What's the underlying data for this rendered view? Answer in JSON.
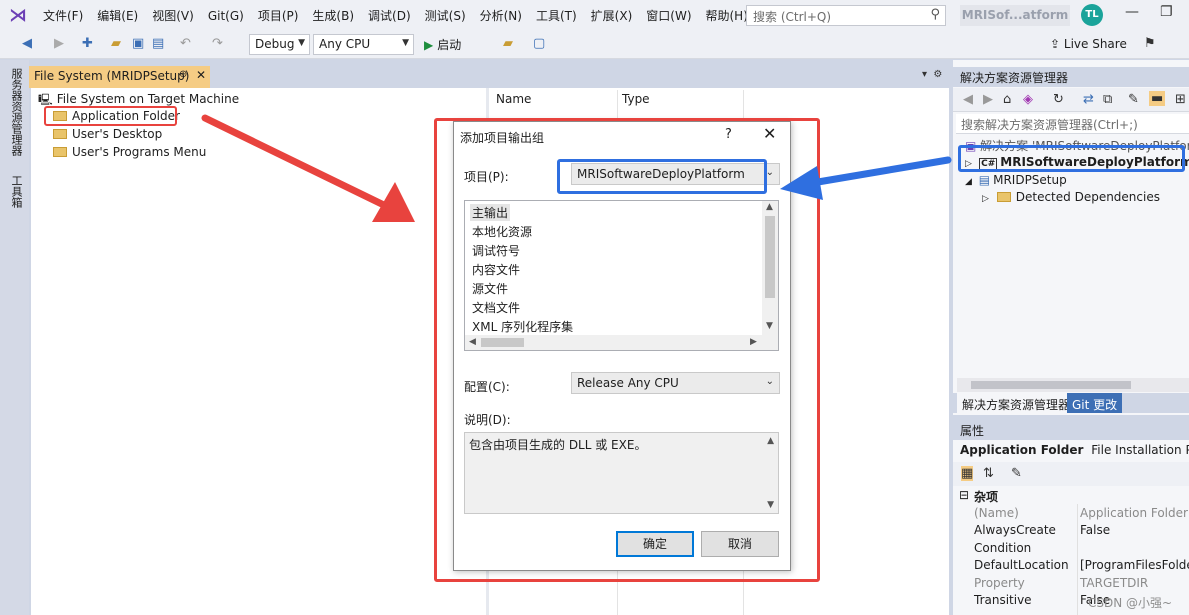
{
  "menubar": {
    "items": [
      "文件(F)",
      "编辑(E)",
      "视图(V)",
      "Git(G)",
      "项目(P)",
      "生成(B)",
      "调试(D)",
      "测试(S)",
      "分析(N)",
      "工具(T)",
      "扩展(X)",
      "窗口(W)",
      "帮助(H)"
    ],
    "search_placeholder": "搜索 (Ctrl+Q)",
    "app_name": "MRISof...atform",
    "avatar_initials": "TL"
  },
  "toolbar": {
    "config": "Debug",
    "platform": "Any CPU",
    "start_label": "启动",
    "live_share": "Live Share"
  },
  "left_strip": {
    "server_explorer": "服务器资源管理器",
    "toolbox": "工具箱"
  },
  "doc_tab": {
    "title": "File System (MRIDPSetup)",
    "pin": "⊕",
    "close": "✕"
  },
  "file_tree": {
    "root": "File System on Target Machine",
    "items": [
      "Application Folder",
      "User's Desktop",
      "User's Programs Menu"
    ]
  },
  "file_list": {
    "columns": [
      "Name",
      "Type"
    ]
  },
  "dialog": {
    "title": "添加项目输出组",
    "help": "?",
    "close": "✕",
    "project_label": "项目(P):",
    "project_value": "MRISoftwareDeployPlatform",
    "outputs": [
      "主输出",
      "本地化资源",
      "调试符号",
      "内容文件",
      "源文件",
      "文档文件",
      "XML 序列化程序集"
    ],
    "config_label": "配置(C):",
    "config_value": "Release Any CPU",
    "desc_label": "说明(D):",
    "desc_text": "包含由项目生成的 DLL 或 EXE。",
    "ok": "确定",
    "cancel": "取消"
  },
  "solution_explorer": {
    "title": "解决方案资源管理器",
    "search_placeholder": "搜索解决方案资源管理器(Ctrl+;)",
    "solution_row": "解决方案 'MRISoftwareDeployPlatform'",
    "project_main": "MRISoftwareDeployPlatform",
    "project_setup": "MRIDPSetup",
    "detected_deps": "Detected Dependencies",
    "tabs": [
      "解决方案资源管理器",
      "Git 更改"
    ]
  },
  "properties": {
    "title": "属性",
    "object_name": "Application Folder",
    "object_type": "File Installation Proper",
    "category": "杂项",
    "rows": [
      {
        "key": "(Name)",
        "value": "Application Folder"
      },
      {
        "key": "AlwaysCreate",
        "value": "False"
      },
      {
        "key": "Condition",
        "value": ""
      },
      {
        "key": "DefaultLocation",
        "value": "[ProgramFilesFolder]"
      },
      {
        "key": "Property",
        "value": "TARGETDIR"
      },
      {
        "key": "Transitive",
        "value": "False"
      }
    ]
  },
  "watermark": "CSDN @小强~",
  "colors": {
    "annotation_red": "#e8433e",
    "annotation_blue": "#2f6fe0",
    "tab_active": "#f5cc84",
    "vs_purple": "#6c3fb5"
  }
}
